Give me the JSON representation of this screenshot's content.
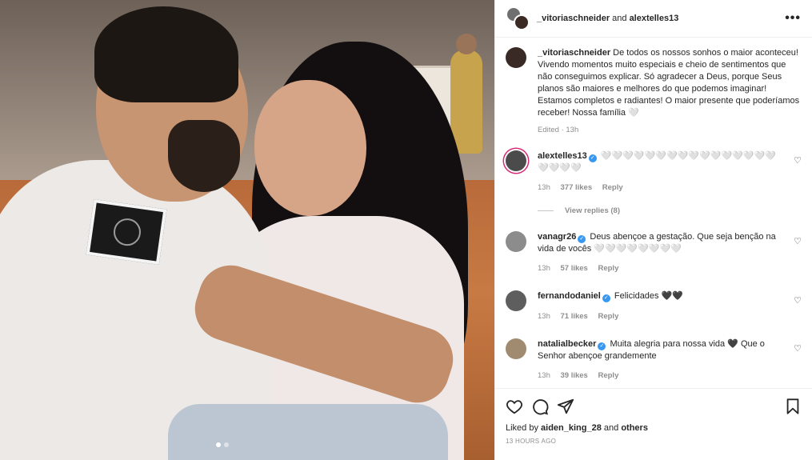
{
  "post": {
    "header_prefix": "_vitoriaschneider",
    "header_joiner": " and ",
    "header_second": "alextelles13",
    "more_label": "•••"
  },
  "caption": {
    "user": "_vitoriaschneider",
    "text": "De todos os nossos sonhos o maior aconteceu! Vivendo momentos muito especiais e cheio de sentimentos que não conseguimos explicar. Só agradecer a Deus, porque Seus planos são maiores e melhores do que podemos imaginar! Estamos completos e radiantes! O maior presente que poderíamos receber! Nossa família 🤍",
    "meta": "Edited · 13h"
  },
  "comments": [
    {
      "user": "alextelles13",
      "verified": true,
      "text": "🤍🤍🤍🤍🤍🤍🤍🤍🤍🤍🤍🤍🤍🤍🤍🤍🤍🤍🤍🤍",
      "time": "13h",
      "likes": "377 likes",
      "reply": "Reply",
      "view_replies": "View replies (8)"
    },
    {
      "user": "vanagr26",
      "verified": true,
      "text": "Deus abençoe a gestação. Que seja benção na vida de vocês 🤍🤍🤍🤍🤍🤍🤍🤍",
      "time": "13h",
      "likes": "57 likes",
      "reply": "Reply"
    },
    {
      "user": "fernandodaniel",
      "verified": true,
      "text": "Felicidades 🖤🖤",
      "time": "13h",
      "likes": "71 likes",
      "reply": "Reply"
    },
    {
      "user": "natalialbecker",
      "verified": true,
      "text": "Muita alegria para nossa vida 🖤 Que o Senhor abençoe grandemente",
      "time": "13h",
      "likes": "39 likes",
      "reply": "Reply"
    }
  ],
  "footer": {
    "liked_prefix": "Liked by ",
    "liked_user": "aiden_king_28",
    "liked_suffix": " and ",
    "liked_others": "others",
    "timestamp": "13 HOURS AGO"
  },
  "carousel": {
    "count": 2,
    "active": 0
  },
  "icons": [
    "heart-icon",
    "comment-icon",
    "share-icon",
    "bookmark-icon",
    "verified-icon",
    "more-icon"
  ],
  "colors": {
    "verified": "#3897f0",
    "muted": "#8e8e8e",
    "text": "#262626"
  }
}
